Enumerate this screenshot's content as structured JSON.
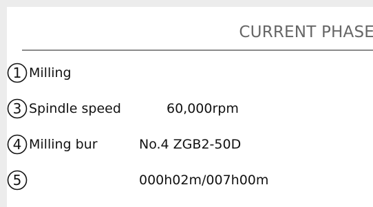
{
  "section": {
    "title": "CURRENT PHASE"
  },
  "rows": [
    {
      "number": "1",
      "label": "Milling",
      "value": ""
    },
    {
      "number": "3",
      "label": "Spindle speed",
      "value": "60,000rpm"
    },
    {
      "number": "4",
      "label": "Milling bur",
      "value": "No.4 ZGB2-50D"
    },
    {
      "number": "5",
      "label": "",
      "value": "000h02m/007h00m"
    }
  ]
}
